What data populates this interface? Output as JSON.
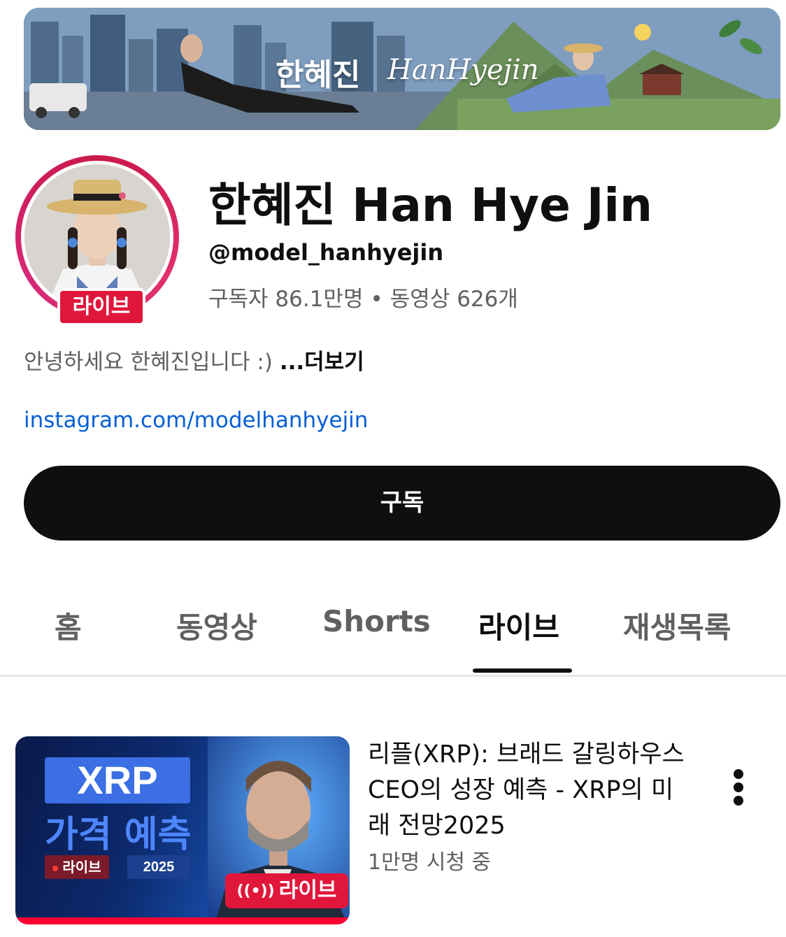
{
  "banner": {
    "name_ko": "한혜진",
    "name_script": "HanHyejin"
  },
  "avatar": {
    "live_badge": "라이브"
  },
  "channel": {
    "name": "한혜진 Han Hye Jin",
    "handle": "@model_hanhyejin",
    "subscribers": "구독자 86.1만명",
    "separator": "•",
    "videos": "동영상 626개",
    "description": "안녕하세요 한혜진입니다 :)",
    "more": "...더보기",
    "link": "instagram.com/modelhanhyejin",
    "subscribe_label": "구독"
  },
  "tabs": [
    {
      "label": "홈",
      "active": false
    },
    {
      "label": "동영상",
      "active": false
    },
    {
      "label": "Shorts",
      "active": false
    },
    {
      "label": "라이브",
      "active": true
    },
    {
      "label": "재생목록",
      "active": false
    }
  ],
  "video": {
    "thumb_xrp": "XRP",
    "thumb_predict": "가격 예측",
    "thumb_live_chip": "라이브",
    "thumb_year": "2025",
    "live_overlay": "라이브",
    "title": "리플(XRP): 브래드 갈링하우스 CEO의 성장 예측 - XRP의 미래 전망2025",
    "meta": "1만명 시청 중"
  },
  "colors": {
    "live_red": "#e0173b",
    "link_blue": "#065fd4",
    "subscribe_bg": "#0f0f0f",
    "secondary_text": "#606060"
  },
  "icons": {
    "kebab": "more-vert-icon",
    "live": "live-broadcast-icon"
  }
}
